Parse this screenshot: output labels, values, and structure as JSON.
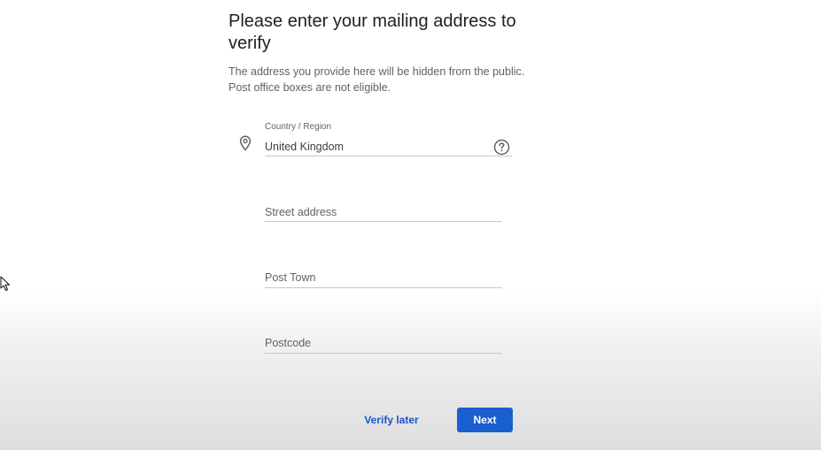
{
  "header": {
    "title": "Please enter your mailing address to verify",
    "description_line1": "The address you provide here will be hidden from the public.",
    "description_line2": "Post office boxes are not eligible."
  },
  "form": {
    "country": {
      "label": "Country / Region",
      "value": "United Kingdom",
      "icon": "location-pin-icon",
      "help_icon": "help-circle-icon"
    },
    "street": {
      "placeholder": "Street address"
    },
    "town": {
      "placeholder": "Post Town"
    },
    "postcode": {
      "placeholder": "Postcode"
    }
  },
  "actions": {
    "verify_later_label": "Verify later",
    "next_label": "Next"
  },
  "colors": {
    "accent": "#1a5fd1",
    "link": "#1a56c8",
    "text_secondary": "#5f6368"
  }
}
